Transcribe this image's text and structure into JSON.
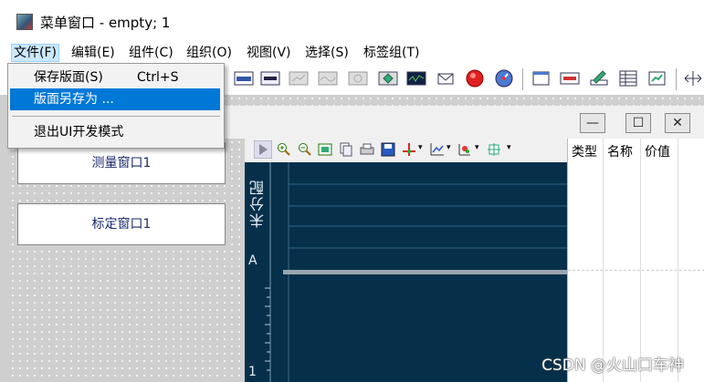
{
  "window": {
    "title": "菜单窗口 - empty; 1"
  },
  "menubar": {
    "items": [
      "文件(F)",
      "编辑(E)",
      "组件(C)",
      "组织(O)",
      "视图(V)",
      "选择(S)",
      "标签组(T)"
    ]
  },
  "file_menu": {
    "items": [
      {
        "label": "保存版面(S)",
        "shortcut": "Ctrl+S"
      },
      {
        "label": "版面另存为 ...",
        "shortcut": ""
      },
      {
        "label": "退出UI开发模式",
        "shortcut": ""
      }
    ]
  },
  "panels": {
    "measure_window": "测量窗口1",
    "calibration_window": "标定窗口1"
  },
  "subwindow": {
    "minimize": "—",
    "restore": "☐",
    "close": "✕"
  },
  "plot": {
    "vertical_label": "未分配",
    "marker_a": "A",
    "marker_1": "1"
  },
  "table": {
    "headers": [
      "类型",
      "名称",
      "价值"
    ]
  },
  "watermark": "CSDN @火山口车神",
  "colors": {
    "plot_bg": "#06304a",
    "highlight": "#0078d7",
    "menu_active": "#cce8ff"
  }
}
